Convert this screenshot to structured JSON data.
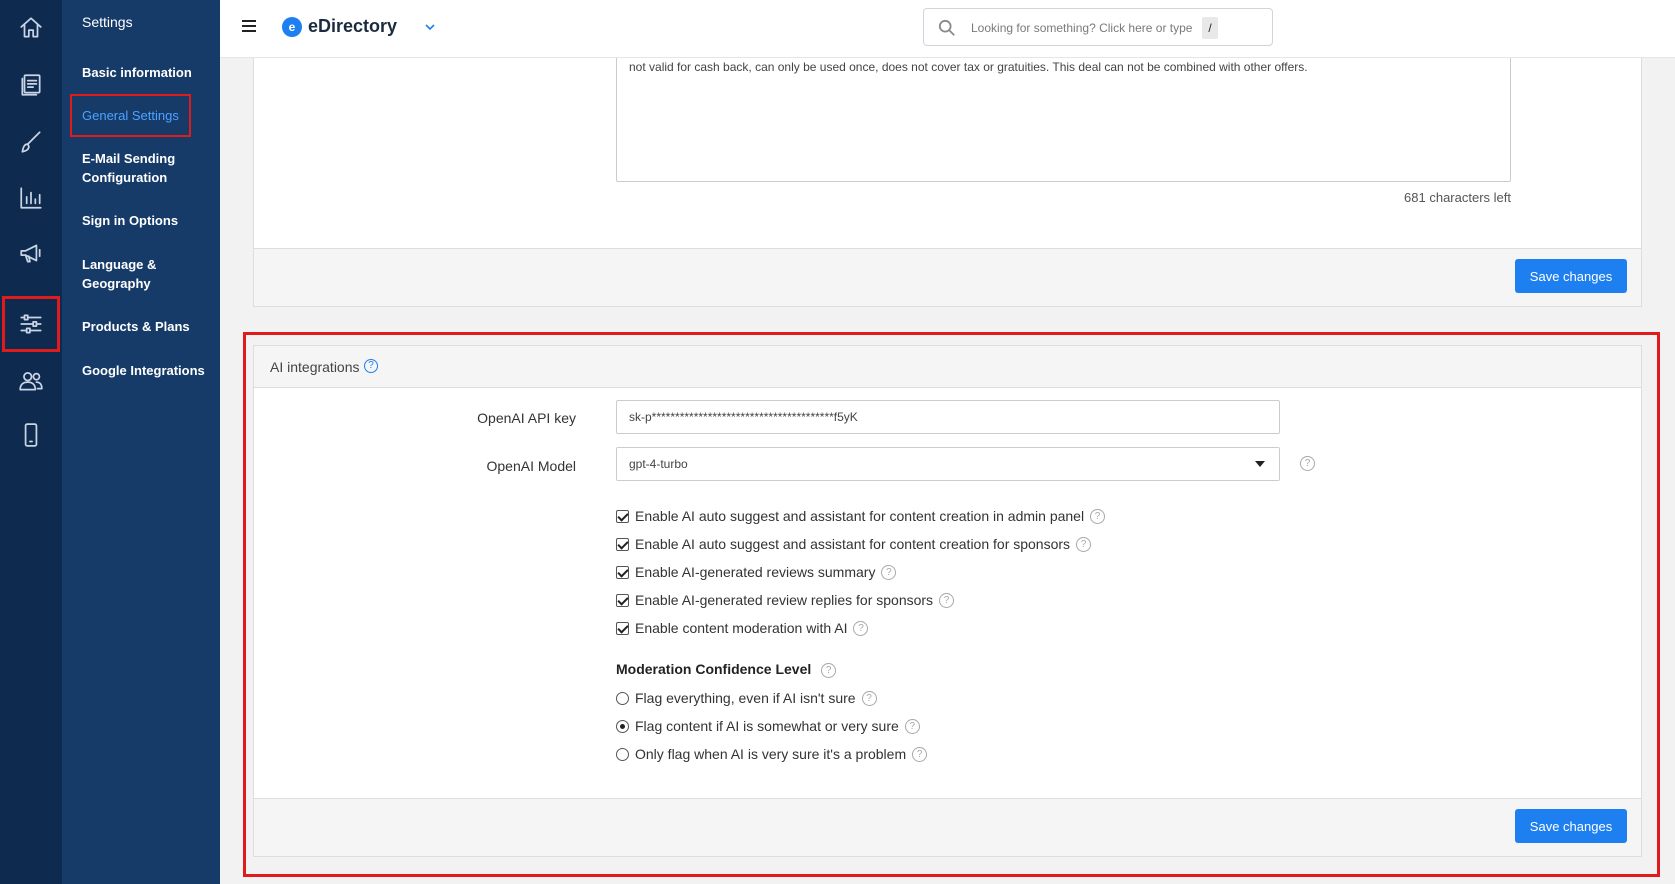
{
  "rail": {
    "items": [
      {
        "icon": "home-icon"
      },
      {
        "icon": "content-icon"
      },
      {
        "icon": "design-icon"
      },
      {
        "icon": "reports-icon"
      },
      {
        "icon": "promote-icon"
      },
      {
        "icon": "settings-sliders-icon",
        "active": true
      },
      {
        "icon": "users-icon"
      },
      {
        "icon": "mobile-icon"
      }
    ]
  },
  "subnav": {
    "title": "Settings",
    "items": [
      {
        "label": "Basic information"
      },
      {
        "label": "General Settings",
        "current": true
      },
      {
        "label": "E-Mail Sending Configuration"
      },
      {
        "label": "Sign in Options"
      },
      {
        "label": "Language & Geography"
      },
      {
        "label": "Products & Plans"
      },
      {
        "label": "Google Integrations"
      }
    ]
  },
  "topbar": {
    "brand_logo_letter": "e",
    "brand_name": "eDirectory",
    "search_placeholder": "Looking for something? Click here or type",
    "search_shortcut": "/"
  },
  "top_panel": {
    "textarea_text": "not valid for cash back, can only be used once, does not cover tax or gratuities. This deal can not be combined with other offers.",
    "chars_left": "681 characters left",
    "save_label": "Save changes"
  },
  "ai_panel": {
    "title": "AI integrations",
    "help_glyph": "?",
    "api_key_label": "OpenAI API key",
    "api_key_value": "sk-p***************************************f5yK",
    "model_label": "OpenAI Model",
    "model_value": "gpt-4-turbo",
    "checkboxes": [
      {
        "label": "Enable AI auto suggest and assistant for content creation in admin panel",
        "checked": true
      },
      {
        "label": "Enable AI auto suggest and assistant for content creation for sponsors",
        "checked": true
      },
      {
        "label": "Enable AI-generated reviews summary",
        "checked": true
      },
      {
        "label": "Enable AI-generated review replies for sponsors",
        "checked": true
      },
      {
        "label": "Enable content moderation with AI",
        "checked": true
      }
    ],
    "moderation_title": "Moderation Confidence Level",
    "radios": [
      {
        "label": "Flag everything, even if AI isn't sure",
        "checked": false
      },
      {
        "label": "Flag content if AI is somewhat or very sure",
        "checked": true
      },
      {
        "label": "Only flag when AI is very sure it's a problem",
        "checked": false
      }
    ],
    "save_label": "Save changes"
  },
  "colors": {
    "rail_bg": "#0e2a4f",
    "subnav_bg": "#163b69",
    "accent": "#1d7ff0",
    "highlight": "#e01b1b"
  }
}
